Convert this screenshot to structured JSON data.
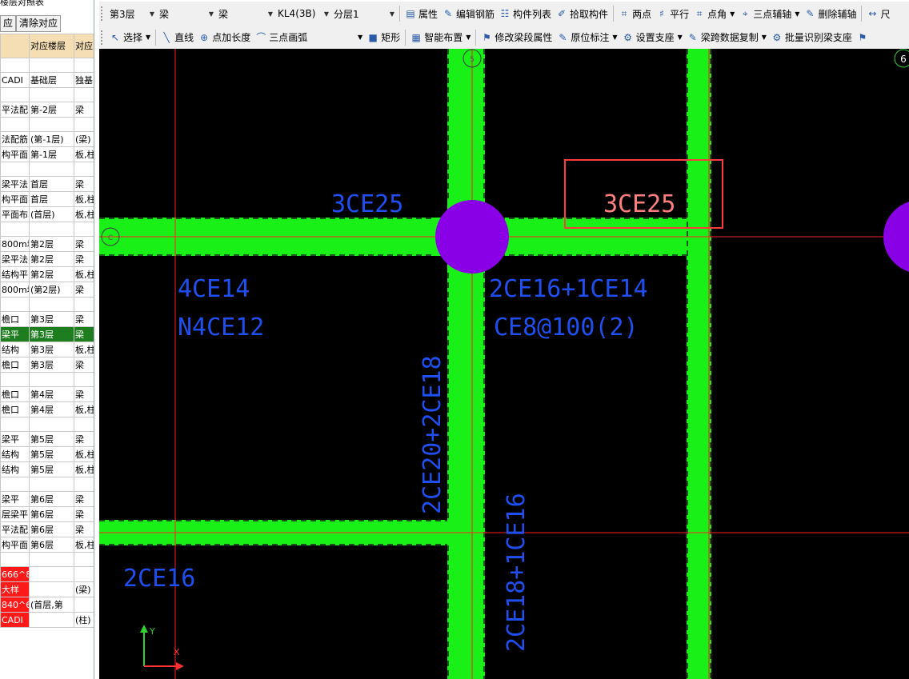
{
  "left_panel": {
    "title": "楼层对照表",
    "buttons": [
      "应",
      "清除对应"
    ],
    "table": {
      "headers": [
        "",
        "对应楼层",
        "对应"
      ],
      "rows": [
        {
          "type": "blank"
        },
        {
          "cells": [
            "CADI",
            "基础层",
            "独基"
          ]
        },
        {
          "type": "blank"
        },
        {
          "cells": [
            "平法配",
            "第-2层",
            "梁"
          ]
        },
        {
          "type": "blank"
        },
        {
          "cells": [
            "法配筋",
            "(第-1层)",
            "(梁)"
          ]
        },
        {
          "cells": [
            "构平面",
            "第-1层",
            "板,柱"
          ]
        },
        {
          "type": "blank"
        },
        {
          "cells": [
            "梁平法",
            "首层",
            "梁"
          ]
        },
        {
          "cells": [
            "构平面",
            "首层",
            "板,柱"
          ]
        },
        {
          "cells": [
            "平面布",
            "(首层)",
            "板,柱"
          ]
        },
        {
          "type": "blank"
        },
        {
          "cells": [
            "800m坡",
            "第2层",
            "梁"
          ]
        },
        {
          "cells": [
            "梁平法",
            "第2层",
            "梁"
          ]
        },
        {
          "cells": [
            "结构平",
            "第2层",
            "板,柱"
          ]
        },
        {
          "cells": [
            "800m坡",
            "(第2层)",
            "梁"
          ]
        },
        {
          "type": "blank"
        },
        {
          "cells": [
            "檐口",
            "第3层",
            "梁"
          ]
        },
        {
          "cells": [
            "梁平",
            "第3层",
            "梁"
          ],
          "selected": true
        },
        {
          "cells": [
            "结构",
            "第3层",
            "板,柱"
          ]
        },
        {
          "cells": [
            "檐口",
            "第3层",
            "梁"
          ]
        },
        {
          "type": "blank"
        },
        {
          "cells": [
            "檐口",
            "第4层",
            "梁"
          ]
        },
        {
          "cells": [
            "檐口",
            "第4层",
            "板,柱"
          ]
        },
        {
          "type": "blank"
        },
        {
          "cells": [
            "梁平",
            "第5层",
            "梁"
          ]
        },
        {
          "cells": [
            "结构",
            "第5层",
            "板,柱"
          ]
        },
        {
          "cells": [
            "结构",
            "第5层",
            "板,柱"
          ]
        },
        {
          "type": "blank"
        },
        {
          "cells": [
            "梁平",
            "第6层",
            "梁"
          ]
        },
        {
          "cells": [
            "层梁平",
            "第6层",
            "梁"
          ]
        },
        {
          "cells": [
            "平法配",
            "第6层",
            "梁"
          ]
        },
        {
          "cells": [
            "构平面",
            "第6层",
            "板,柱"
          ]
        },
        {
          "type": "blank"
        },
        {
          "cells": [
            "666^8",
            "",
            ""
          ],
          "red": true
        },
        {
          "cells": [
            "大样",
            "",
            "(梁)"
          ],
          "red": true
        },
        {
          "cells": [
            "840^6",
            "(首层,第",
            ""
          ],
          "red": true
        },
        {
          "cells": [
            "CADI",
            "",
            "(柱)"
          ],
          "red": true
        }
      ]
    }
  },
  "toolbar1": {
    "floor_select": "第3层",
    "type_select": "梁",
    "subtype_select": "梁",
    "component_select": "KL4(3B)",
    "layer_select": "分层1",
    "buttons": [
      {
        "icon": "properties-icon",
        "glyph": "▤",
        "label": "属性"
      },
      {
        "icon": "edit-rebar-icon",
        "glyph": "✎",
        "label": "编辑钢筋"
      },
      {
        "icon": "component-list-icon",
        "glyph": "☷",
        "label": "构件列表"
      },
      {
        "icon": "pick-component-icon",
        "glyph": "✐",
        "label": "拾取构件"
      },
      {
        "icon": "two-point-icon",
        "glyph": "⌗",
        "label": "两点"
      },
      {
        "icon": "parallel-icon",
        "glyph": "♯",
        "label": "平行"
      },
      {
        "icon": "point-angle-icon",
        "glyph": "⌗",
        "label": "点角",
        "dropdown": true
      },
      {
        "icon": "three-point-axis-icon",
        "glyph": "⌖",
        "label": "三点辅轴",
        "dropdown": true
      },
      {
        "icon": "delete-axis-icon",
        "glyph": "✎",
        "label": "删除辅轴"
      },
      {
        "icon": "dimension-icon",
        "glyph": "↔",
        "label": "尺"
      }
    ]
  },
  "toolbar2": {
    "buttons": [
      {
        "icon": "select-cursor-icon",
        "glyph": "↖",
        "label": "选择",
        "dropdown": true
      },
      {
        "icon": "line-icon",
        "glyph": "╲",
        "label": "直线"
      },
      {
        "icon": "point-length-icon",
        "glyph": "⊕",
        "label": "点加长度"
      },
      {
        "icon": "three-point-arc-icon",
        "glyph": "⌒",
        "label": "三点画弧",
        "dropdown": true,
        "wide": true
      },
      {
        "icon": "rectangle-icon",
        "glyph": "■",
        "label": "矩形"
      },
      {
        "icon": "smart-layout-icon",
        "glyph": "▦",
        "label": "智能布置",
        "dropdown": true
      },
      {
        "icon": "modify-span-props-icon",
        "glyph": "⚑",
        "label": "修改梁段属性"
      },
      {
        "icon": "in-place-annotation-icon",
        "glyph": "✎",
        "label": "原位标注",
        "dropdown": true
      },
      {
        "icon": "set-support-icon",
        "glyph": "⚙",
        "label": "设置支座",
        "dropdown": true
      },
      {
        "icon": "span-data-copy-icon",
        "glyph": "✎",
        "label": "梁跨数据复制",
        "dropdown": true
      },
      {
        "icon": "batch-identify-support-icon",
        "glyph": "⚙",
        "label": "批量识别梁支座"
      },
      {
        "icon": "more-icon",
        "glyph": "⚑",
        "label": ""
      }
    ]
  },
  "canvas": {
    "colors": {
      "background": "#000000",
      "beam": "#18f018",
      "column": "#8a00e6",
      "axis": "#ff2020",
      "text": "#1f4ff0",
      "selected_text": "#ff7f7f",
      "selection_box": "#ff3b3b"
    },
    "axis_bubbles": [
      "5",
      "6",
      "C"
    ],
    "annotations": [
      {
        "id": "top-rebar-left",
        "text": "3CE25"
      },
      {
        "id": "top-rebar-right",
        "text": "3CE25",
        "selected": true
      },
      {
        "id": "bottom-rebar-left",
        "text": "4CE14"
      },
      {
        "id": "side-rebar-left",
        "text": "N4CE12"
      },
      {
        "id": "bottom-rebar-right",
        "text": "2CE16+1CE14"
      },
      {
        "id": "stirrup-right",
        "text": "CE8@100(2)"
      },
      {
        "id": "vertical-rebar-upper",
        "text": "2CE20+2CE18"
      },
      {
        "id": "vertical-rebar-lower",
        "text": "2CE18+1CE16"
      },
      {
        "id": "bottom-left-rebar",
        "text": "2CE16"
      }
    ],
    "ucs": {
      "x_label": "X",
      "y_label": "Y"
    }
  }
}
